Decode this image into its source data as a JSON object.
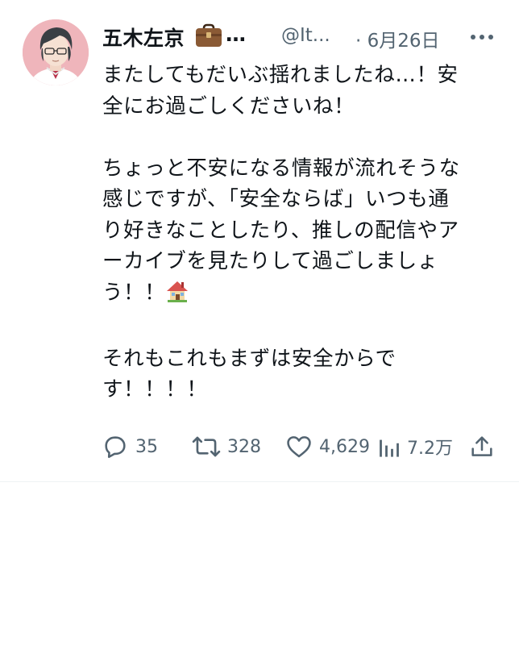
{
  "tweet": {
    "author": {
      "display_name": "五木左京",
      "name_badge": "briefcase-emoji",
      "name_ellipsis": "…",
      "handle": "@It...",
      "avatar": "avatar-illustration"
    },
    "date": "· 6月26日",
    "more_icon": "more-horizontal-icon",
    "text_lines": [
      "またしてもだいぶ揺れましたね…！安",
      "全にお過ごしくださいね！",
      "",
      "ちょっと不安になる情報が流れそうな",
      "感じですが、「安全ならば」いつも通",
      "り好きなことしたり、推しの配信やア",
      "ーカイブを見たりして過ごしましょ",
      "う！！"
    ],
    "house_emoji": "house-emoji",
    "text_lines_after": [
      "",
      "それもこれもまずは安全からで",
      "す！！！！"
    ],
    "actions": {
      "replies": "35",
      "reposts": "328",
      "likes": "4,629",
      "views": "7.2万"
    },
    "colors": {
      "text": "#0f1419",
      "secondary": "#536471",
      "avatar_bg": "#efb5bb",
      "divider": "#eff3f4"
    }
  }
}
